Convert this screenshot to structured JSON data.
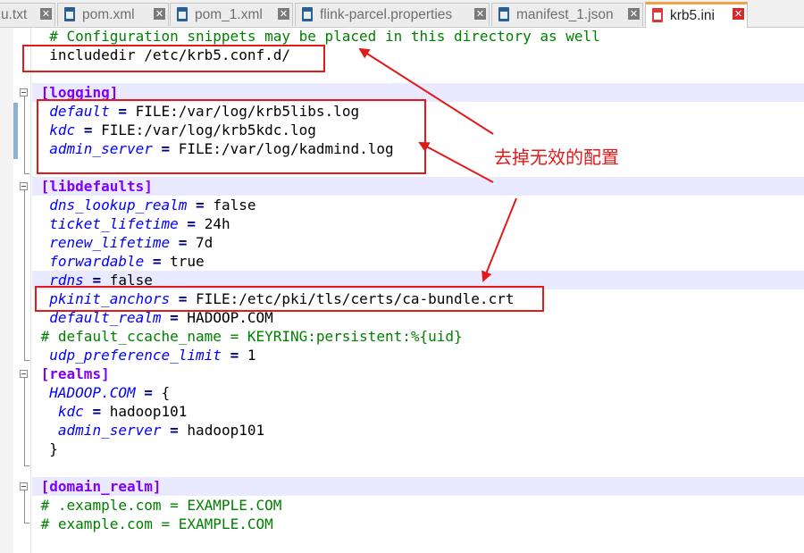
{
  "tabs": [
    {
      "label": "u.txt",
      "active": false,
      "icon": "file-icon"
    },
    {
      "label": "pom.xml",
      "active": false,
      "icon": "file-icon"
    },
    {
      "label": "pom_1.xml",
      "active": false,
      "icon": "file-icon"
    },
    {
      "label": "flink-parcel.properties",
      "active": false,
      "icon": "file-icon"
    },
    {
      "label": "manifest_1.json",
      "active": false,
      "icon": "file-icon"
    },
    {
      "label": "krb5.ini",
      "active": true,
      "icon": "file-icon"
    }
  ],
  "tab_close_glyph": "✕",
  "editor": {
    "lines": {
      "l1": {
        "comment": "# Configuration snippets may be placed in this directory as well"
      },
      "l2": {
        "text": "includedir /etc/krb5.conf.d/"
      },
      "l4": {
        "section": "[logging]"
      },
      "l5": {
        "key": "default",
        "op": "=",
        "value": "FILE:/var/log/krb5libs.log"
      },
      "l6": {
        "key": "kdc",
        "op": "=",
        "value": "FILE:/var/log/krb5kdc.log"
      },
      "l7": {
        "key": "admin_server",
        "op": "=",
        "value": "FILE:/var/log/kadmind.log"
      },
      "l9": {
        "section": "[libdefaults]"
      },
      "l10": {
        "key": "dns_lookup_realm",
        "op": "=",
        "value": "false"
      },
      "l11": {
        "key": "ticket_lifetime",
        "op": "=",
        "value": "24h"
      },
      "l12": {
        "key": "renew_lifetime",
        "op": "=",
        "value": "7d"
      },
      "l13": {
        "key": "forwardable",
        "op": "=",
        "value": "true"
      },
      "l14": {
        "key": "rdns",
        "op": "=",
        "value": "false"
      },
      "l15": {
        "key": "pkinit_anchors",
        "op": "=",
        "value": "FILE:/etc/pki/tls/certs/ca-bundle.crt"
      },
      "l16": {
        "key": "default_realm",
        "op": "=",
        "value": "HADOOP.COM"
      },
      "l17": {
        "comment": "# default_ccache_name = KEYRING:persistent:%{uid}"
      },
      "l18": {
        "key": "udp_preference_limit",
        "op": "=",
        "value": "1"
      },
      "l19": {
        "section": "[realms]"
      },
      "l20": {
        "key": "HADOOP.COM",
        "op": "=",
        "value": "{"
      },
      "l21": {
        "key": "kdc",
        "op": "=",
        "value": "hadoop101"
      },
      "l22": {
        "key": "admin_server",
        "op": "=",
        "value": "hadoop101"
      },
      "l23": {
        "text": "}"
      },
      "l25": {
        "section": "[domain_realm]"
      },
      "l26": {
        "comment": "# .example.com = EXAMPLE.COM"
      },
      "l27": {
        "comment": "# example.com = EXAMPLE.COM"
      }
    }
  },
  "annotation": {
    "note": "去掉无效的配置",
    "color": "#e11a1a"
  },
  "colors": {
    "comment": "#008000",
    "section": "#8000ff",
    "key": "#0000ff",
    "operator": "#000080",
    "current_line": "#e9e9ff",
    "active_tab_accent": "#f0a44a"
  }
}
